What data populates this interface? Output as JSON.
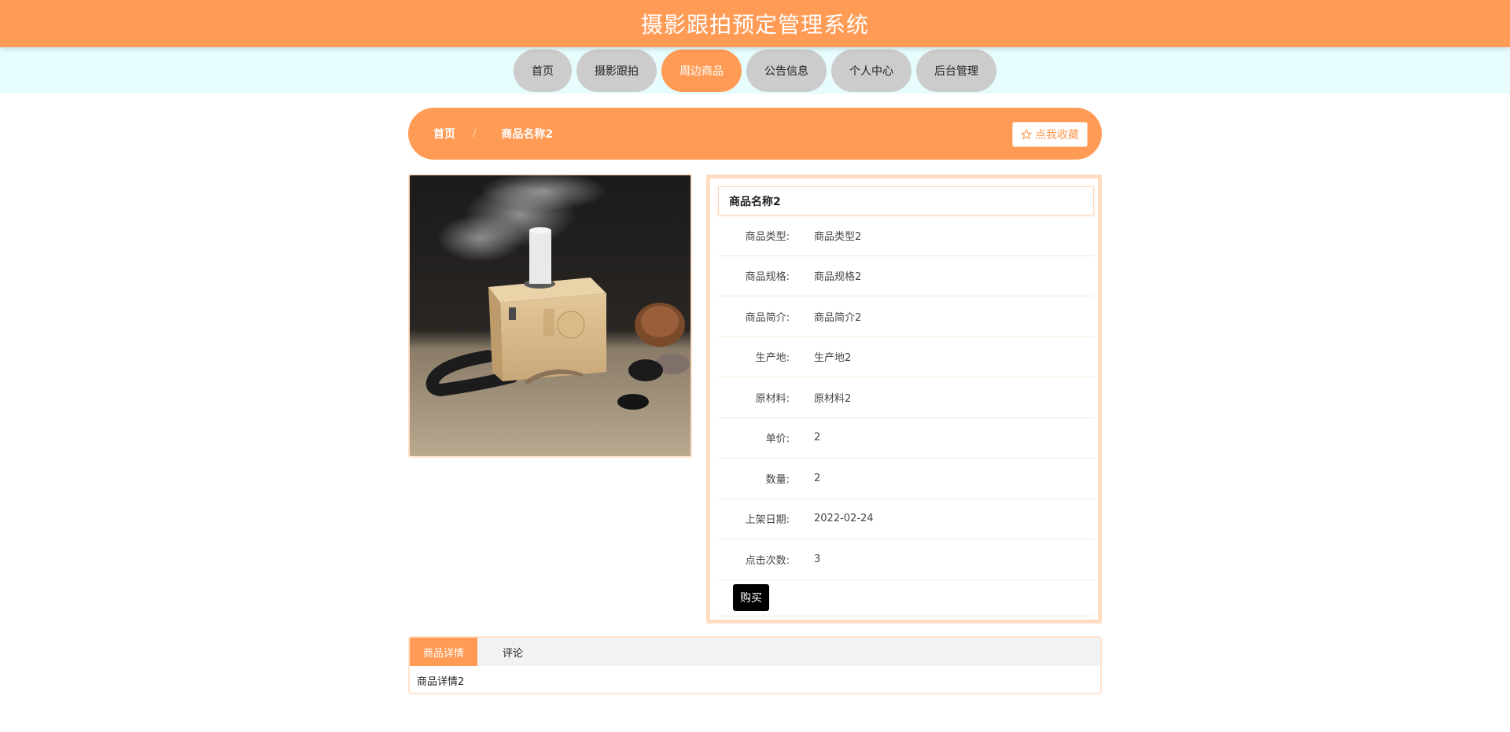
{
  "header": {
    "title": "摄影跟拍预定管理系统"
  },
  "nav": {
    "items": [
      {
        "label": "首页"
      },
      {
        "label": "摄影跟拍"
      },
      {
        "label": "周边商品"
      },
      {
        "label": "公告信息"
      },
      {
        "label": "个人中心"
      },
      {
        "label": "后台管理"
      }
    ],
    "active_index": 2
  },
  "breadcrumb": {
    "home": "首页",
    "separator": "/",
    "current": "商品名称2",
    "favorite_button": "点我收藏"
  },
  "product": {
    "image_icon": "moxibustion-box-photo",
    "name": "商品名称2",
    "fields": [
      {
        "label": "商品类型:",
        "value": "商品类型2"
      },
      {
        "label": "商品规格:",
        "value": "商品规格2"
      },
      {
        "label": "商品简介:",
        "value": "商品简介2"
      },
      {
        "label": "生产地:",
        "value": "生产地2"
      },
      {
        "label": "原材料:",
        "value": "原材料2"
      },
      {
        "label": "单价:",
        "value": "2"
      },
      {
        "label": "数量:",
        "value": "2"
      },
      {
        "label": "上架日期:",
        "value": "2022-02-24"
      },
      {
        "label": "点击次数:",
        "value": "3"
      }
    ],
    "buy_button": "购买"
  },
  "tabs": {
    "items": [
      {
        "label": "商品详情"
      },
      {
        "label": "评论"
      }
    ],
    "active_index": 0,
    "content": "商品详情2"
  },
  "colors": {
    "accent": "#ff9b55",
    "nav_bg": "#e6fcfd",
    "nav_inactive": "#cccccc",
    "buy_button": "#000000"
  }
}
